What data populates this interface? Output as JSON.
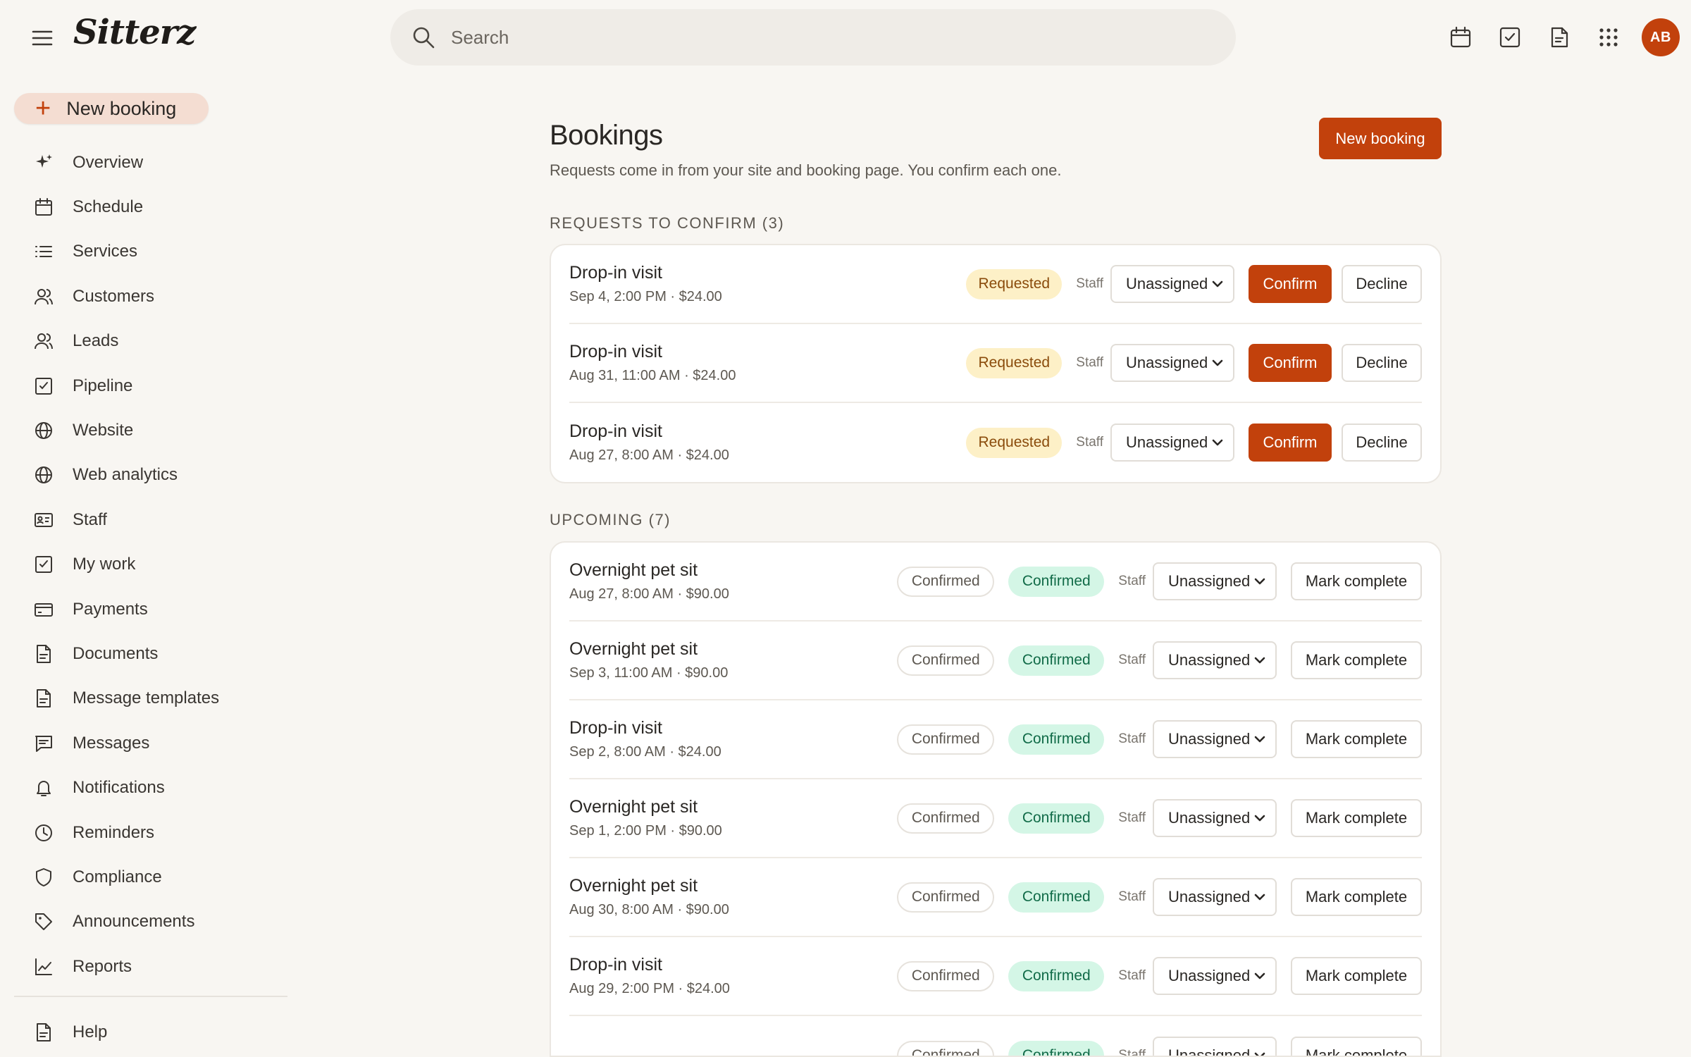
{
  "app": {
    "logo": "Sitterz"
  },
  "search": {
    "placeholder": "Search"
  },
  "topbar": {
    "icons": [
      "calendar-icon",
      "checkbox-icon",
      "document-icon",
      "apps-grid-icon"
    ],
    "avatar_initials": "AB",
    "accent": "#c2410c"
  },
  "sidebar": {
    "new_booking": "New booking",
    "items": [
      {
        "label": "Overview",
        "icon": "sparkle-icon"
      },
      {
        "label": "Schedule",
        "icon": "calendar-icon"
      },
      {
        "label": "Services",
        "icon": "list-icon"
      },
      {
        "label": "Customers",
        "icon": "users-icon"
      },
      {
        "label": "Leads",
        "icon": "users-icon"
      },
      {
        "label": "Pipeline",
        "icon": "checkbox-icon"
      },
      {
        "label": "Website",
        "icon": "globe-icon"
      },
      {
        "label": "Web analytics",
        "icon": "globe-icon"
      },
      {
        "label": "Staff",
        "icon": "id-card-icon"
      },
      {
        "label": "My work",
        "icon": "checkbox-icon"
      },
      {
        "label": "Payments",
        "icon": "credit-card-icon"
      },
      {
        "label": "Documents",
        "icon": "document-icon"
      },
      {
        "label": "Message templates",
        "icon": "document-icon"
      },
      {
        "label": "Messages",
        "icon": "message-icon"
      },
      {
        "label": "Notifications",
        "icon": "bell-icon"
      },
      {
        "label": "Reminders",
        "icon": "clock-icon"
      },
      {
        "label": "Compliance",
        "icon": "shield-icon"
      },
      {
        "label": "Announcements",
        "icon": "tag-icon"
      },
      {
        "label": "Reports",
        "icon": "chart-icon"
      }
    ],
    "help": {
      "label": "Help",
      "icon": "document-icon"
    }
  },
  "main": {
    "title": "Bookings",
    "subtitle": "Requests come in from your site and booking page. You confirm each one.",
    "new_booking_button": "New booking",
    "requests": {
      "heading": "REQUESTS TO CONFIRM (3)",
      "status_label": "Requested",
      "staff_label": "Staff",
      "staff_value": "Unassigned",
      "confirm_label": "Confirm",
      "decline_label": "Decline",
      "rows": [
        {
          "title": "Drop-in visit",
          "meta": "Sep 4, 2:00 PM · $24.00"
        },
        {
          "title": "Drop-in visit",
          "meta": "Aug 31, 11:00 AM · $24.00"
        },
        {
          "title": "Drop-in visit",
          "meta": "Aug 27, 8:00 AM · $24.00"
        }
      ]
    },
    "upcoming": {
      "heading": "UPCOMING (7)",
      "status_label": "Confirmed",
      "badge_label": "Confirmed",
      "staff_label": "Staff",
      "staff_value": "Unassigned",
      "complete_label": "Mark complete",
      "rows": [
        {
          "title": "Overnight pet sit",
          "meta": "Aug 27, 8:00 AM · $90.00"
        },
        {
          "title": "Overnight pet sit",
          "meta": "Sep 3, 11:00 AM · $90.00"
        },
        {
          "title": "Drop-in visit",
          "meta": "Sep 2, 8:00 AM · $24.00"
        },
        {
          "title": "Overnight pet sit",
          "meta": "Sep 1, 2:00 PM · $90.00"
        },
        {
          "title": "Overnight pet sit",
          "meta": "Aug 30, 8:00 AM · $90.00"
        },
        {
          "title": "Drop-in visit",
          "meta": "Aug 29, 2:00 PM · $24.00"
        },
        {
          "title": "",
          "meta": ""
        }
      ]
    }
  }
}
